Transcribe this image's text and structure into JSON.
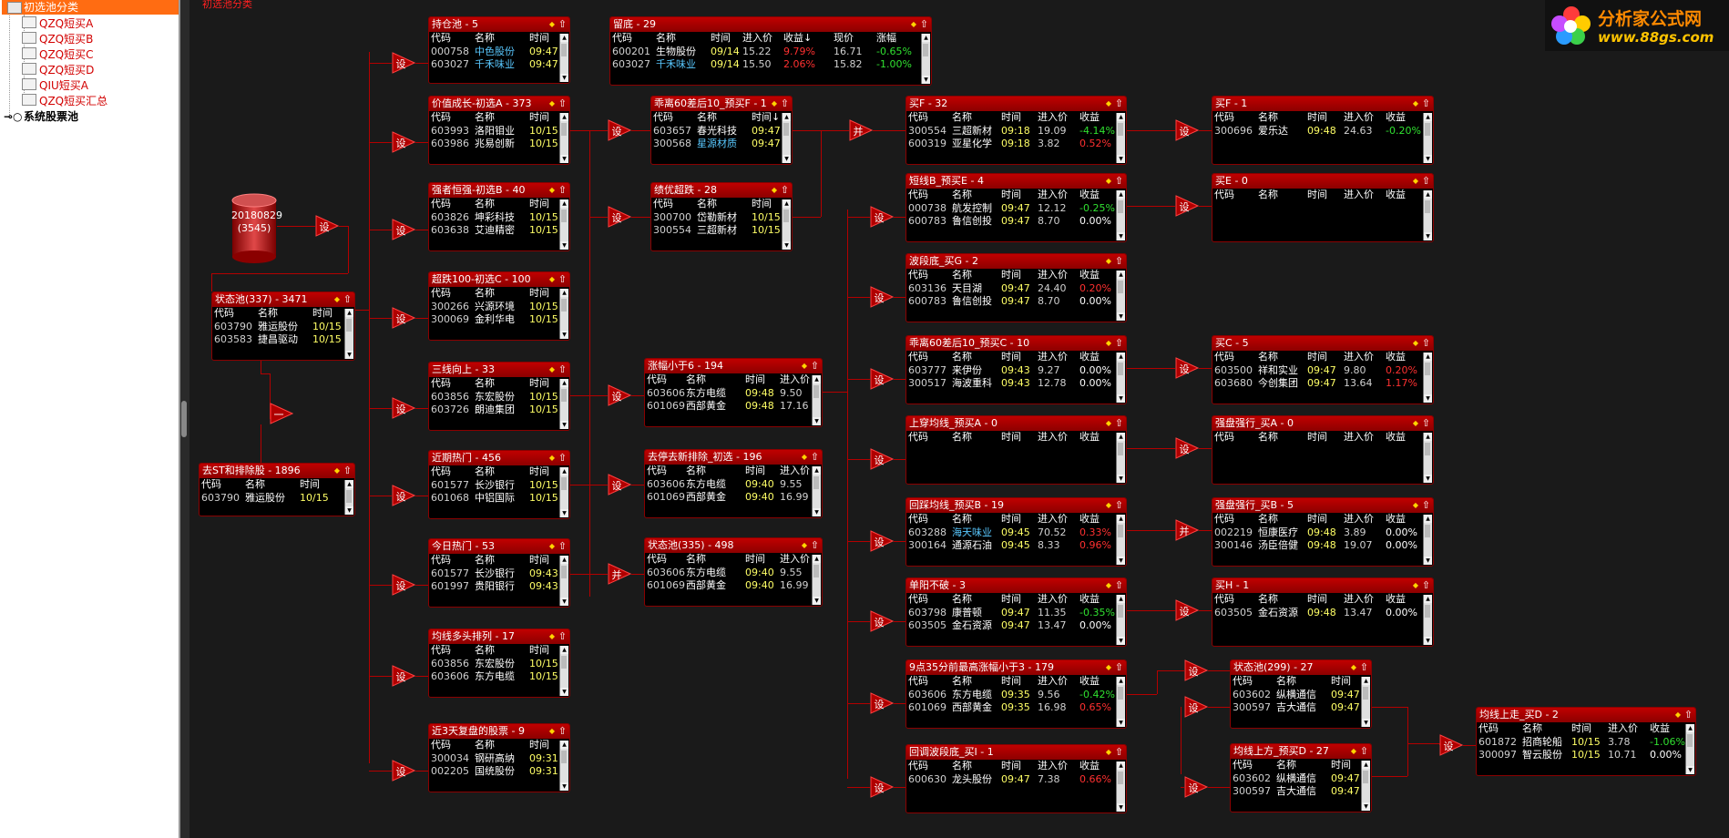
{
  "sidebar": {
    "root": "初选池分类",
    "children": [
      "QZQ短买A",
      "QZQ短买B",
      "QZQ短买C",
      "QZQ短买D",
      "QIU短买A",
      "QZQ短买汇总"
    ],
    "system": "系统股票池"
  },
  "cutoff_text": "初选池分类",
  "logo": {
    "line1": "分析家公式网",
    "line2": "www.88gs.com"
  },
  "cylinder": {
    "date": "20180829",
    "count": "(3545)"
  },
  "triangle_labels": {
    "set": "设",
    "merge": "并",
    "minus": "一"
  },
  "colors": {
    "panel_header": "#c00000",
    "connector": "#b40000",
    "positive": "#ff3030",
    "negative": "#30e030",
    "name_blue": "#59c8ff",
    "time_yellow": "#ffff66"
  },
  "panels": [
    {
      "id": "p_state",
      "title": "状态池(337) - 3471",
      "cols": [
        "代码",
        "名称",
        "时间"
      ],
      "rows": [
        [
          "603790",
          "雅运股份",
          "10/15"
        ],
        [
          "603583",
          "捷昌驱动",
          "10/15"
        ]
      ]
    },
    {
      "id": "p_st",
      "title": "去ST和排除股 - 1896",
      "cols": [
        "代码",
        "名称",
        "时间"
      ],
      "rows": [
        [
          "603790",
          "雅运股份",
          "10/15"
        ]
      ]
    },
    {
      "id": "p_hold",
      "title": "持仓池 - 5",
      "cols": [
        "代码",
        "名称",
        "时间"
      ],
      "rows": [
        [
          "000758",
          "中色股份",
          "09:47"
        ],
        [
          "603027",
          "千禾味业",
          "09:47"
        ]
      ]
    },
    {
      "id": "p_liudi",
      "title": "留底 - 29",
      "cols": [
        "代码",
        "名称",
        "时间",
        "进入价",
        "收益↓",
        "现价",
        "涨幅"
      ],
      "rows": [
        [
          "600201",
          "生物股份",
          "09/14",
          "15.22",
          "9.79%",
          "16.71",
          "-0.65%"
        ],
        [
          "603027",
          "千禾味业",
          "09/14",
          "15.50",
          "2.06%",
          "15.82",
          "-1.00%"
        ]
      ]
    },
    {
      "id": "p_a373",
      "title": "价值成长-初选A - 373",
      "cols": [
        "代码",
        "名称",
        "时间"
      ],
      "rows": [
        [
          "603993",
          "洛阳钼业",
          "10/15"
        ],
        [
          "603986",
          "兆易创新",
          "10/15"
        ]
      ]
    },
    {
      "id": "p_b40",
      "title": "强者恒强-初选B - 40",
      "cols": [
        "代码",
        "名称",
        "时间"
      ],
      "rows": [
        [
          "603826",
          "坤彩科技",
          "10/15"
        ],
        [
          "603638",
          "艾迪精密",
          "10/15"
        ]
      ]
    },
    {
      "id": "p_c100",
      "title": "超跌100-初选C - 100",
      "cols": [
        "代码",
        "名称",
        "时间"
      ],
      "rows": [
        [
          "300266",
          "兴源环境",
          "10/15"
        ],
        [
          "300069",
          "金利华电",
          "10/15"
        ]
      ]
    },
    {
      "id": "p_sx33",
      "title": "三线向上 - 33",
      "cols": [
        "代码",
        "名称",
        "时间"
      ],
      "rows": [
        [
          "603856",
          "东宏股份",
          "10/15"
        ],
        [
          "603726",
          "朗迪集团",
          "10/15"
        ]
      ]
    },
    {
      "id": "p_jq456",
      "title": "近期热门 - 456",
      "cols": [
        "代码",
        "名称",
        "时间"
      ],
      "rows": [
        [
          "601577",
          "长沙银行",
          "10/15"
        ],
        [
          "601068",
          "中铝国际",
          "10/15"
        ]
      ]
    },
    {
      "id": "p_jr53",
      "title": "今日热门 - 53",
      "cols": [
        "代码",
        "名称",
        "时间"
      ],
      "rows": [
        [
          "601577",
          "长沙银行",
          "09:43"
        ],
        [
          "601997",
          "贵阳银行",
          "09:43"
        ]
      ]
    },
    {
      "id": "p_jx17",
      "title": "均线多头排列 - 17",
      "cols": [
        "代码",
        "名称",
        "时间"
      ],
      "rows": [
        [
          "603856",
          "东宏股份",
          "10/15"
        ],
        [
          "603606",
          "东方电缆",
          "10/15"
        ]
      ]
    },
    {
      "id": "p_j3",
      "title": "近3天复盘的股票 - 9",
      "cols": [
        "代码",
        "名称",
        "时间"
      ],
      "rows": [
        [
          "300034",
          "钢研高纳",
          "09:31"
        ],
        [
          "002205",
          "国统股份",
          "09:31"
        ]
      ]
    },
    {
      "id": "p_f1",
      "title": "乖离60差后10_预买F - 1",
      "cols": [
        "代码",
        "名称",
        "时间↓"
      ],
      "rows": [
        [
          "603657",
          "春光科技",
          "09:47"
        ],
        [
          "300568",
          "星源材质",
          "09:47"
        ]
      ]
    },
    {
      "id": "p_jy28",
      "title": "绩优超跌 - 28",
      "cols": [
        "代码",
        "名称",
        "时间"
      ],
      "rows": [
        [
          "300700",
          "岱勒新材",
          "10/15"
        ],
        [
          "300554",
          "三超新材",
          "10/15"
        ]
      ]
    },
    {
      "id": "p_zf194",
      "title": "涨幅小于6 - 194",
      "cols": [
        "代码",
        "名称",
        "时间",
        "进入价"
      ],
      "rows": [
        [
          "603606",
          "东方电缆",
          "09:48",
          "9.50"
        ],
        [
          "601069",
          "西部黄金",
          "09:48",
          "17.16"
        ]
      ]
    },
    {
      "id": "p_qt196",
      "title": "去停去新排除_初选 - 196",
      "cols": [
        "代码",
        "名称",
        "时间",
        "进入价"
      ],
      "rows": [
        [
          "603606",
          "东方电缆",
          "09:40",
          "9.55"
        ],
        [
          "601069",
          "西部黄金",
          "09:40",
          "16.99"
        ]
      ]
    },
    {
      "id": "p_zt498",
      "title": "状态池(335) - 498",
      "cols": [
        "代码",
        "名称",
        "时间",
        "进入价"
      ],
      "rows": [
        [
          "603606",
          "东方电缆",
          "09:40",
          "9.55"
        ],
        [
          "601069",
          "西部黄金",
          "09:40",
          "16.99"
        ]
      ]
    },
    {
      "id": "p_f32",
      "title": "买F - 32",
      "cols": [
        "代码",
        "名称",
        "时间",
        "进入价",
        "收益"
      ],
      "rows": [
        [
          "300554",
          "三超新材",
          "09:18",
          "19.09",
          "-4.14%"
        ],
        [
          "600319",
          "亚星化学",
          "09:18",
          "3.82",
          "0.52%"
        ]
      ]
    },
    {
      "id": "p_e4",
      "title": "短线B_预买E - 4",
      "cols": [
        "代码",
        "名称",
        "时间",
        "进入价",
        "收益"
      ],
      "rows": [
        [
          "000738",
          "航发控制",
          "09:47",
          "12.12",
          "-0.25%"
        ],
        [
          "600783",
          "鲁信创投",
          "09:47",
          "8.70",
          "0.00%"
        ]
      ]
    },
    {
      "id": "p_g2",
      "title": "波段底_买G - 2",
      "cols": [
        "代码",
        "名称",
        "时间",
        "进入价",
        "收益"
      ],
      "rows": [
        [
          "603136",
          "天目湖",
          "09:47",
          "24.40",
          "0.20%"
        ],
        [
          "600783",
          "鲁信创投",
          "09:47",
          "8.70",
          "0.00%"
        ]
      ]
    },
    {
      "id": "p_c10",
      "title": "乖离60差后10_预买C - 10",
      "cols": [
        "代码",
        "名称",
        "时间",
        "进入价",
        "收益"
      ],
      "rows": [
        [
          "603777",
          "来伊份",
          "09:43",
          "9.27",
          "0.00%"
        ],
        [
          "300517",
          "海波重科",
          "09:43",
          "12.78",
          "0.00%"
        ]
      ]
    },
    {
      "id": "p_a0",
      "title": "上穿均线_预买A - 0",
      "cols": [
        "代码",
        "名称",
        "时间",
        "进入价",
        "收益"
      ],
      "rows": []
    },
    {
      "id": "p_b19",
      "title": "回踩均线_预买B - 19",
      "cols": [
        "代码",
        "名称",
        "时间",
        "进入价",
        "收益"
      ],
      "rows": [
        [
          "603288",
          "海天味业",
          "09:45",
          "70.52",
          "0.33%"
        ],
        [
          "300164",
          "通源石油",
          "09:45",
          "8.33",
          "0.96%"
        ]
      ]
    },
    {
      "id": "p_dy3",
      "title": "单阳不破 - 3",
      "cols": [
        "代码",
        "名称",
        "时间",
        "进入价",
        "收益"
      ],
      "rows": [
        [
          "603798",
          "康普顿",
          "09:47",
          "11.35",
          "-0.35%"
        ],
        [
          "603505",
          "金石资源",
          "09:47",
          "13.47",
          "0.00%"
        ]
      ]
    },
    {
      "id": "p_935",
      "title": "9点35分前最高涨幅小于3 - 179",
      "cols": [
        "代码",
        "名称",
        "时间",
        "进入价",
        "收益"
      ],
      "rows": [
        [
          "603606",
          "东方电缆",
          "09:35",
          "9.56",
          "-0.42%"
        ],
        [
          "601069",
          "西部黄金",
          "09:35",
          "16.98",
          "0.65%"
        ]
      ]
    },
    {
      "id": "p_i1",
      "title": "回调波段底_买I - 1",
      "cols": [
        "代码",
        "名称",
        "时间",
        "进入价",
        "收益"
      ],
      "rows": [
        [
          "600630",
          "龙头股份",
          "09:47",
          "7.38",
          "0.66%"
        ]
      ]
    },
    {
      "id": "p_bf1",
      "title": "买F - 1",
      "cols": [
        "代码",
        "名称",
        "时间",
        "进入价",
        "收益"
      ],
      "rows": [
        [
          "300696",
          "爱乐达",
          "09:48",
          "24.63",
          "-0.20%"
        ]
      ]
    },
    {
      "id": "p_be0",
      "title": "买E - 0",
      "cols": [
        "代码",
        "名称",
        "时间",
        "进入价",
        "收益"
      ],
      "rows": []
    },
    {
      "id": "p_bc5",
      "title": "买C - 5",
      "cols": [
        "代码",
        "名称",
        "时间",
        "进入价",
        "收益"
      ],
      "rows": [
        [
          "603500",
          "祥和实业",
          "09:47",
          "9.80",
          "0.20%"
        ],
        [
          "603680",
          "今创集团",
          "09:47",
          "13.64",
          "1.17%"
        ]
      ]
    },
    {
      "id": "p_qa0",
      "title": "强盘强行_买A - 0",
      "cols": [
        "代码",
        "名称",
        "时间",
        "进入价",
        "收益"
      ],
      "rows": []
    },
    {
      "id": "p_qb5",
      "title": "强盘强行_买B - 5",
      "cols": [
        "代码",
        "名称",
        "时间",
        "进入价",
        "收益"
      ],
      "rows": [
        [
          "002219",
          "恒康医疗",
          "09:48",
          "3.89",
          "0.00%"
        ],
        [
          "300146",
          "汤臣倍健",
          "09:48",
          "19.07",
          "0.00%"
        ]
      ]
    },
    {
      "id": "p_h1",
      "title": "买H - 1",
      "cols": [
        "代码",
        "名称",
        "时间",
        "进入价",
        "收益"
      ],
      "rows": [
        [
          "603505",
          "金石资源",
          "09:48",
          "13.47",
          "0.00%"
        ]
      ]
    },
    {
      "id": "p_zt27",
      "title": "状态池(299) - 27",
      "cols": [
        "代码",
        "名称",
        "时间"
      ],
      "rows": [
        [
          "603602",
          "纵横通信",
          "09:47"
        ],
        [
          "300597",
          "吉大通信",
          "09:47"
        ]
      ]
    },
    {
      "id": "p_jxd27",
      "title": "均线上方_预买D - 27",
      "cols": [
        "代码",
        "名称",
        "时间"
      ],
      "rows": [
        [
          "603602",
          "纵横通信",
          "09:47"
        ],
        [
          "300597",
          "吉大通信",
          "09:47"
        ]
      ]
    },
    {
      "id": "p_d2",
      "title": "均线上走_买D - 2",
      "cols": [
        "代码",
        "名称",
        "时间",
        "进入价",
        "收益"
      ],
      "rows": [
        [
          "601872",
          "招商轮船",
          "10/15",
          "3.78",
          "-1.06%"
        ],
        [
          "300097",
          "智云股份",
          "10/15",
          "10.71",
          "0.00%"
        ]
      ]
    }
  ]
}
